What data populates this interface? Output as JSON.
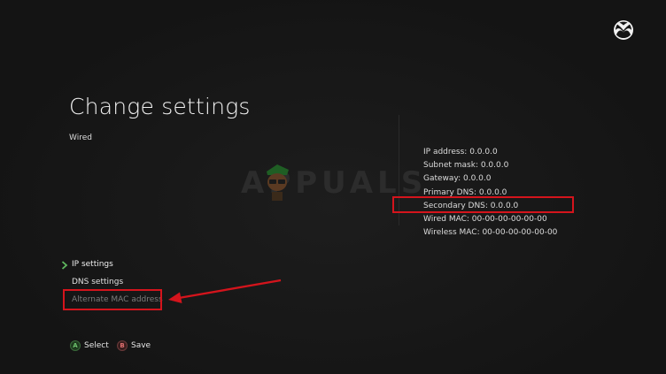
{
  "header": {
    "title": "Change settings",
    "subtitle": "Wired"
  },
  "watermark": {
    "text": "APPUALS"
  },
  "network_info": {
    "ip_address": "IP address: 0.0.0.0",
    "subnet_mask": "Subnet mask: 0.0.0.0",
    "gateway": "Gateway: 0.0.0.0",
    "primary_dns": "Primary DNS: 0.0.0.0",
    "secondary_dns": "Secondary DNS: 0.0.0.0",
    "wired_mac": "Wired MAC: 00-00-00-00-00-00",
    "wireless_mac": "Wireless MAC: 00-00-00-00-00-00"
  },
  "menu": {
    "items": [
      {
        "label": "IP settings",
        "state": "focused"
      },
      {
        "label": "DNS settings",
        "state": "normal"
      },
      {
        "label": "Alternate MAC address",
        "state": "disabled"
      }
    ]
  },
  "footer": {
    "select": {
      "key": "A",
      "label": "Select"
    },
    "save": {
      "key": "B",
      "label": "Save"
    }
  },
  "icons": {
    "logo": "xbox-logo-icon",
    "focus": "chevron-right-icon",
    "annotation": "red-arrow-icon"
  },
  "colors": {
    "background": "#161616",
    "highlight": "#d4141c",
    "focus_green": "#5fb85f",
    "button_a": "#6ec26e",
    "button_b": "#e07070"
  }
}
